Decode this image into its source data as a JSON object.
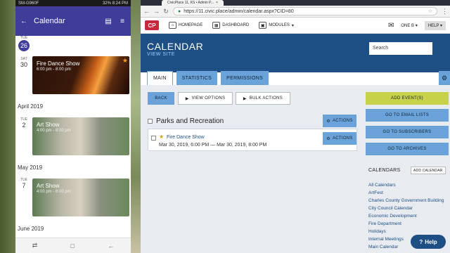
{
  "phone": {
    "status": {
      "left": "SM-G960F",
      "right": "32% 8:24 PM"
    },
    "appbar_title": "Calendar",
    "current_day": {
      "weekday": "TUE",
      "number": "26"
    },
    "events": [
      {
        "weekday": "SAT",
        "day": "30",
        "title": "Fire Dance Show",
        "time": "6:00 pm - 8:00 pm",
        "starred": true
      },
      {
        "weekday": "TUE",
        "day": "2",
        "title": "Art Show",
        "time": "4:00 pm - 8:00 pm",
        "starred": false
      },
      {
        "weekday": "TUE",
        "day": "7",
        "title": "Art Show",
        "time": "4:00 pm - 8:00 pm",
        "starred": false
      }
    ],
    "months": [
      "April 2019",
      "May 2019",
      "June 2019"
    ]
  },
  "browser": {
    "tab_title": "CivicPlace 11, KS • Admin P...",
    "url": "https://11.civic.place/admin/calendar.aspx?CID=80",
    "nav": {
      "logo": "CP",
      "home": "HOMEPAGE",
      "dashboard": "DASHBOARD",
      "modules": "MODULES",
      "one": "ONE B",
      "help": "HELP"
    },
    "page_title": "CALENDAR",
    "view_site": "VIEW SITE",
    "search_placeholder": "Search",
    "tabs": [
      "MAIN",
      "STATISTICS",
      "PERMISSIONS"
    ],
    "buttons": {
      "back": "BACK",
      "view_options": "VIEW OPTIONS",
      "bulk_actions": "BULK ACTIONS",
      "actions": "ACTIONS"
    },
    "group": "Parks and Recreation",
    "event": {
      "name": "Fire Dance Show",
      "dates": "Mar 30, 2019, 6:00 PM — Mar 30, 2019, 8:00 PM"
    },
    "side_buttons": [
      "ADD EVENT(S)",
      "GO TO EMAIL LISTS",
      "GO TO SUBSCRIBERS",
      "GO TO ARCHIVES"
    ],
    "calendars_heading": "CALENDARS",
    "add_calendar": "ADD CALENDAR",
    "calendars": [
      "All Calendars",
      "ArtFest",
      "Charles County Government Building",
      "City Council Calendar",
      "Economic Development",
      "Fire Department",
      "Holidays",
      "Internal Meetings",
      "Main Calendar"
    ],
    "help_button": "Help"
  }
}
